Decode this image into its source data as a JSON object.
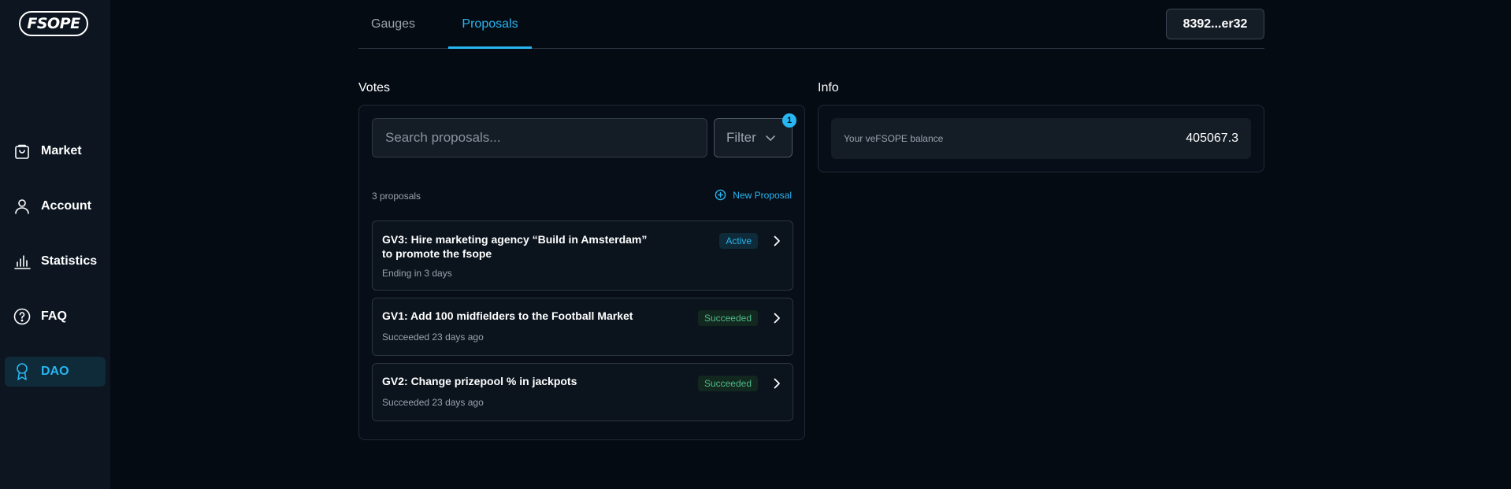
{
  "sidebar": {
    "logo": "FSOPE",
    "items": [
      {
        "label": "Market",
        "icon": "shopping-bag-icon"
      },
      {
        "label": "Account",
        "icon": "user-icon"
      },
      {
        "label": "Statistics",
        "icon": "bar-chart-icon"
      },
      {
        "label": "FAQ",
        "icon": "question-circle-icon"
      },
      {
        "label": "DAO",
        "icon": "award-icon",
        "active": true
      }
    ]
  },
  "header": {
    "tabs": [
      {
        "label": "Gauges"
      },
      {
        "label": "Proposals",
        "active": true
      }
    ],
    "wallet": "8392...er32"
  },
  "votes": {
    "title": "Votes",
    "search_placeholder": "Search proposals...",
    "filter_label": "Filter",
    "filter_count": "1",
    "count_label": "3 proposals",
    "new_proposal_label": "New Proposal",
    "proposals": [
      {
        "title_line1": "GV3: Hire marketing agency “Build in Amsterdam”",
        "title_line2": "to promote the fsope",
        "subtitle": "Ending in 3 days",
        "status": "Active"
      },
      {
        "title_line1": "GV1: Add 100 midfielders to the Football Market",
        "subtitle": "Succeeded 23 days ago",
        "status": "Succeeded"
      },
      {
        "title_line1": "GV2: Change prizepool % in jackpots",
        "subtitle": "Succeeded 23 days ago",
        "status": "Succeeded"
      }
    ]
  },
  "info": {
    "title": "Info",
    "balance_label": "Your veFSOPE balance",
    "balance_value": "405067.3"
  },
  "colors": {
    "accent": "#27b6f2",
    "success": "#4fb889",
    "background": "#050b13",
    "sidebar": "#0c1520"
  }
}
